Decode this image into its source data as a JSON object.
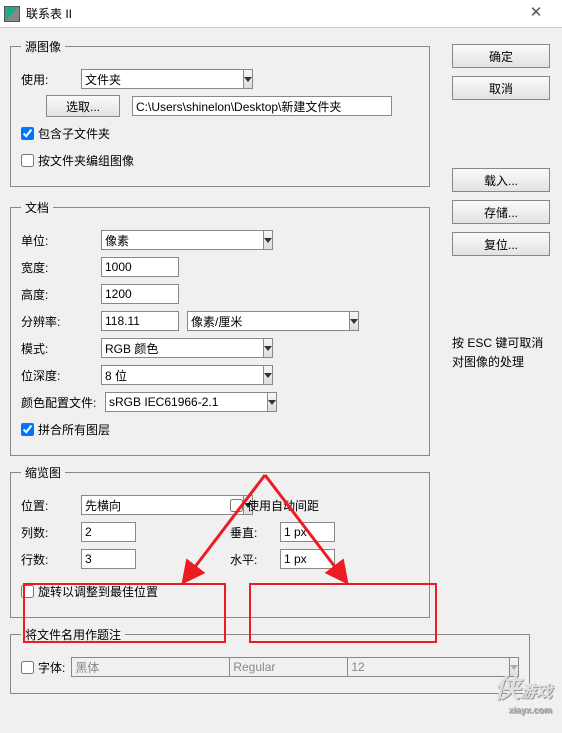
{
  "window": {
    "title": "联系表 II"
  },
  "buttons": {
    "ok": "确定",
    "cancel": "取消",
    "load": "载入...",
    "save": "存储...",
    "reset": "复位...",
    "choose": "选取..."
  },
  "hint": {
    "line1": "按 ESC 键可取消",
    "line2": "对图像的处理"
  },
  "source": {
    "legend": "源图像",
    "use_lbl": "使用:",
    "use_val": "文件夹",
    "path": "C:\\Users\\shinelon\\Desktop\\新建文件夹",
    "inc_sub": "包含子文件夹",
    "group_by": "按文件夹编组图像"
  },
  "doc": {
    "legend": "文档",
    "unit_lbl": "单位:",
    "unit_val": "像素",
    "width_lbl": "宽度:",
    "width_val": "1000",
    "height_lbl": "高度:",
    "height_val": "1200",
    "res_lbl": "分辨率:",
    "res_val": "118.11",
    "res_unit": "像素/厘米",
    "mode_lbl": "模式:",
    "mode_val": "RGB 颜色",
    "depth_lbl": "位深度:",
    "depth_val": "8 位",
    "profile_lbl": "颜色配置文件:",
    "profile_val": "sRGB IEC61966-2.1",
    "flatten": "拼合所有图层"
  },
  "thumb": {
    "legend": "缩览图",
    "place_lbl": "位置:",
    "place_val": "先横向",
    "cols_lbl": "列数:",
    "cols_val": "2",
    "rows_lbl": "行数:",
    "rows_val": "3",
    "auto": "使用自动间距",
    "vert_lbl": "垂直:",
    "vert_val": "1 px",
    "horz_lbl": "水平:",
    "horz_val": "1 px",
    "rotate": "旋转以调整到最佳位置"
  },
  "caption": {
    "legend": "将文件名用作题注",
    "font_lbl": "字体:",
    "font_val": "黑体",
    "weight": "Regular",
    "size": "12"
  },
  "watermark": {
    "brand": "侠",
    "sub": "游戏",
    "url": "xiayx.com"
  }
}
